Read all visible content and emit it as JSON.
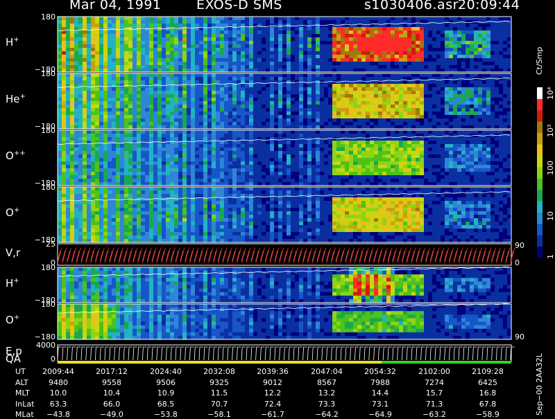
{
  "header": {
    "date": "Mar 04, 1991",
    "instrument": "EXOS-D SMS",
    "file": "s1030406.asr",
    "time": "20:09:44"
  },
  "chart_data": {
    "type": "heatmap",
    "panels": [
      {
        "id": "h1",
        "label": "H",
        "sup": "+",
        "ytop": "180",
        "ybot": "−180",
        "species": "h"
      },
      {
        "id": "he",
        "label": "He",
        "sup": "+",
        "ytop": "180",
        "ybot": "−180",
        "species": "he"
      },
      {
        "id": "opp",
        "label": "O",
        "sup": "++",
        "ytop": "180",
        "ybot": "−180",
        "species": "opp"
      },
      {
        "id": "o1",
        "label": "O",
        "sup": "+",
        "ytop": "180",
        "ybot": "−180",
        "species": "o"
      },
      {
        "id": "vr",
        "label": "V,r",
        "sup": "",
        "ytop": "25",
        "ybot": "0",
        "right_top": "90",
        "right_bot": "0"
      },
      {
        "id": "h2",
        "label": "H",
        "sup": "+",
        "ytop": "180",
        "ybot": "−180",
        "species": "h2"
      },
      {
        "id": "o2",
        "label": "O",
        "sup": "+",
        "ytop": "180",
        "ybot": "−180",
        "species": "o2",
        "right_bot": "90"
      },
      {
        "id": "ep",
        "label": "E,p",
        "sup": "",
        "ytop": "4000",
        "ybot": "0"
      }
    ],
    "qa_label": "QA",
    "colorbar": {
      "unit": "Ct/Smp",
      "ticks": [
        "10⁴",
        "10³",
        "100",
        "10",
        "1"
      ]
    },
    "ephemeris": {
      "keys": [
        "UT",
        "ALT",
        "MLT",
        "InLat",
        "MLat"
      ],
      "rows": [
        [
          "2009:44",
          "2017:12",
          "2024:40",
          "2032:08",
          "2039:36",
          "2047:04",
          "2054:32",
          "2102:00",
          "2109:28"
        ],
        [
          "9480",
          "9558",
          "9506",
          "9325",
          "9012",
          "8567",
          "7988",
          "7274",
          "6425"
        ],
        [
          "10.0",
          "10.4",
          "10.9",
          "11.5",
          "12.2",
          "13.2",
          "14.4",
          "15.7",
          "16.8"
        ],
        [
          "63.3",
          "66.0",
          "68.5",
          "70.7",
          "72.4",
          "73.3",
          "73.1",
          "71.3",
          "67.8"
        ],
        [
          "−43.8",
          "−49.0",
          "−53.8",
          "−58.1",
          "−61.7",
          "−64.2",
          "−64.9",
          "−63.2",
          "−58.9"
        ]
      ]
    },
    "side_text": "Sep−00  2AA32L"
  }
}
